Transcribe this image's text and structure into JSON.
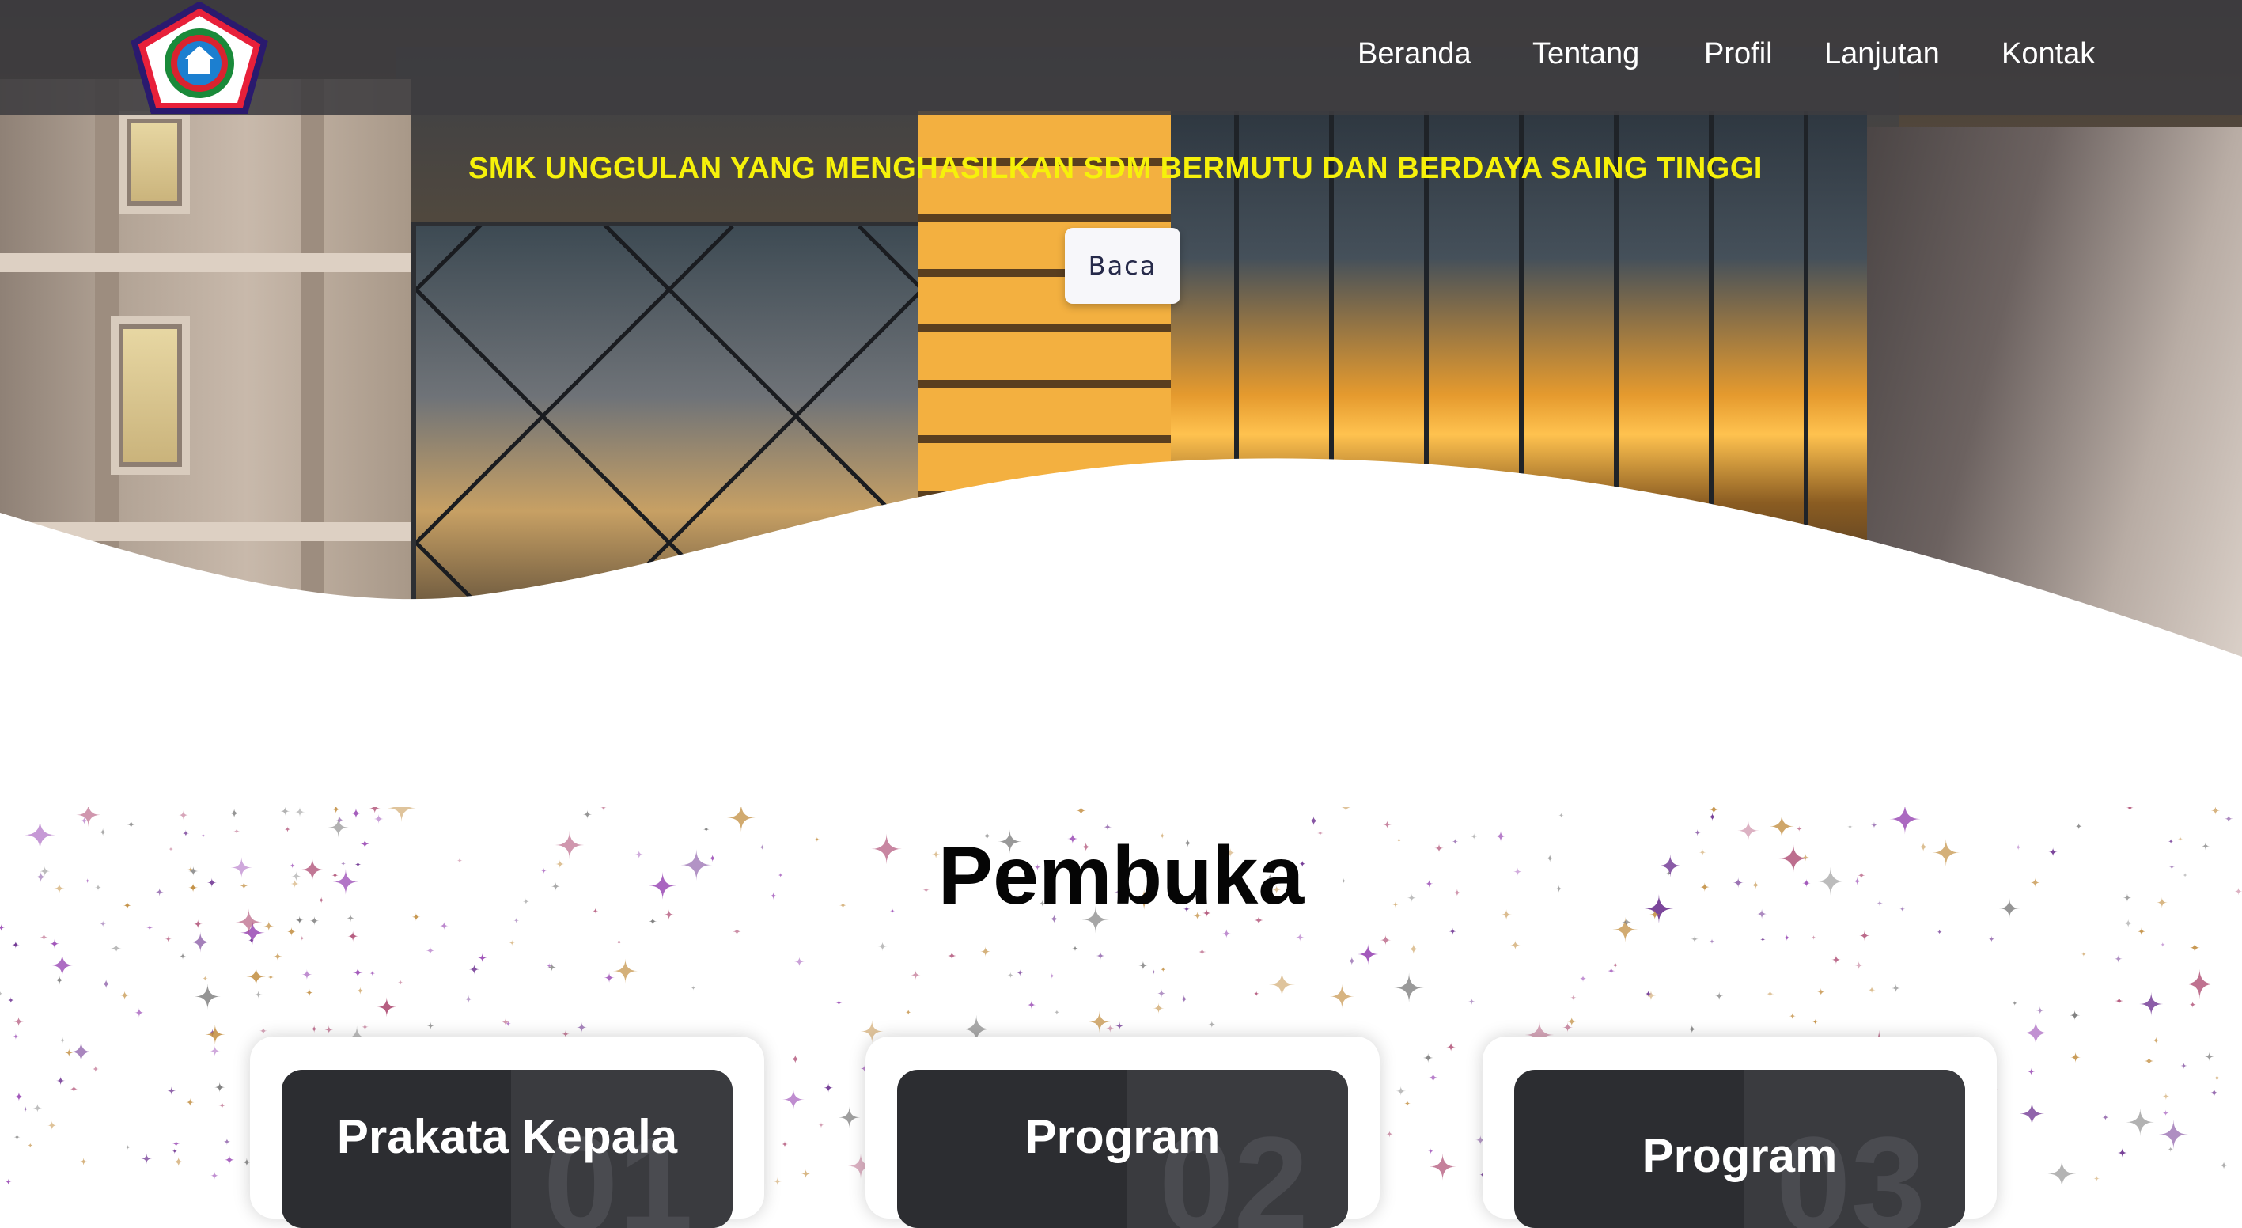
{
  "nav": {
    "logo_icon": "school-logo-pentagon-icon",
    "items": [
      {
        "label": "Beranda"
      },
      {
        "label": "Tentang"
      },
      {
        "label": "Profil"
      },
      {
        "label": "Lanjutan"
      },
      {
        "label": "Kontak"
      }
    ]
  },
  "hero": {
    "tagline": "SMK UNGGULAN YANG MENGHASILKAN SDM BERMUTU DAN BERDAYA SAING TINGGI",
    "button_label": "Baca",
    "tagline_color": "#f6f10a"
  },
  "section": {
    "title": "Pembuka",
    "cards": [
      {
        "title": "Prakata Kepala",
        "number": "01"
      },
      {
        "title": "Program",
        "number": "02"
      },
      {
        "title": "Program",
        "number": "03"
      }
    ]
  }
}
